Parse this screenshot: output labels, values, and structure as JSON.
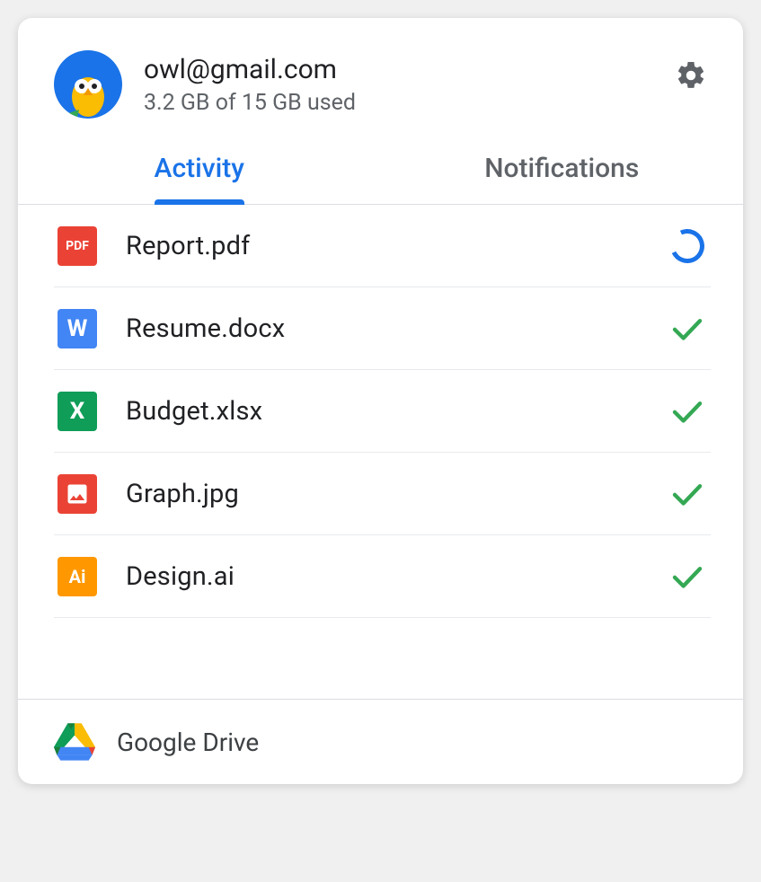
{
  "header": {
    "email": "owl@gmail.com",
    "storage": "3.2 GB of 15 GB used"
  },
  "tabs": {
    "activity": "Activity",
    "notifications": "Notifications"
  },
  "files": [
    {
      "name": "Report.pdf",
      "icon_label": "PDF",
      "icon_bg": "#ea4335",
      "status": "uploading"
    },
    {
      "name": "Resume.docx",
      "icon_label": "W",
      "icon_bg": "#4285f4",
      "status": "done"
    },
    {
      "name": "Budget.xlsx",
      "icon_label": "X",
      "icon_bg": "#0f9d58",
      "status": "done"
    },
    {
      "name": "Graph.jpg",
      "icon_label": "img",
      "icon_bg": "#ea4335",
      "status": "done"
    },
    {
      "name": "Design.ai",
      "icon_label": "Ai",
      "icon_bg": "#ff9800",
      "status": "done"
    }
  ],
  "footer": {
    "label": "Google Drive"
  }
}
